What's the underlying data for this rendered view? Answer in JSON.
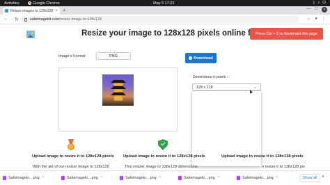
{
  "os_bar": {
    "activities": "Activities",
    "app_name": "Google Chrome",
    "clock": "May 9  17:23",
    "icons": [
      "network-icon",
      "volume-icon",
      "power-icon"
    ]
  },
  "browser": {
    "tab_title": "Resize images to 128x128",
    "tab_close": "×",
    "new_tab": "+",
    "url_host": "safeimagekit.com",
    "url_path": "/resize-image-to-128x128",
    "back": "←",
    "forward": "→",
    "reload": "↻",
    "minimize": "—",
    "maximize": "□",
    "close": "×"
  },
  "page": {
    "title": "Resize your image to 128x128 pixels online for fr",
    "bookmark_toast": "Press Ctrl + D to Bookmark this page",
    "format_label": "Image's Format",
    "format_value": "PNG",
    "download_label": "Download",
    "dimensions_label": "Dimensions in pixels :-",
    "dimensions_value": "128 x 128",
    "features": [
      {
        "icon": "medal-icon",
        "title": "Upload image to resize it to 128x128 pixels",
        "text": "With the aid of our resizer image to 128x128"
      },
      {
        "icon": "shield-check-icon",
        "title": "Upload image to resize it to 128x128 pixels",
        "text": "This resizer image to 128x128 dimensions"
      },
      {
        "title": "Upload image to resize it to 128x128 pixels",
        "text": "o resize it to 128x128 pix"
      }
    ]
  },
  "download_shelf": {
    "items": [
      "Safeimageki....png",
      "Safeimageki....png",
      "Safeimageki....png",
      "Safeimageki....png",
      "Safeimageki....png"
    ],
    "show_all": "Show all",
    "close": "×"
  },
  "colors": {
    "primary_button": "#1976d2",
    "toast": "#e8534a",
    "shield": "#2fa24a",
    "medal": "#f2b632"
  }
}
